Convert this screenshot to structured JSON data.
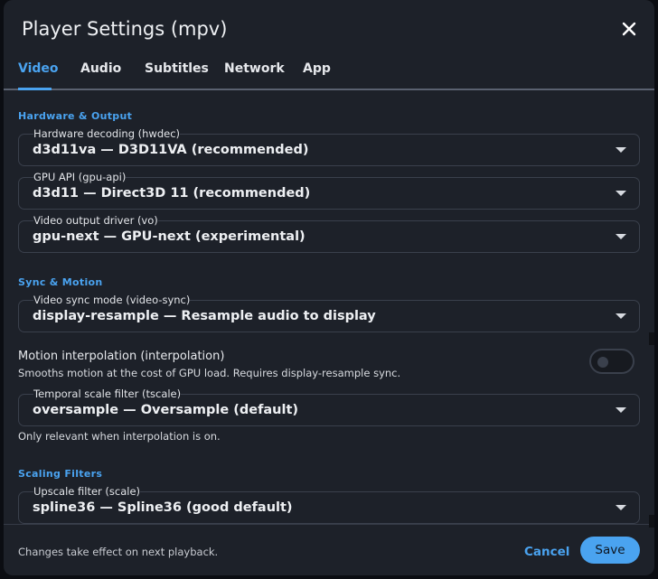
{
  "dialog": {
    "title": "Player Settings (mpv)",
    "close_icon": "close-icon"
  },
  "tabs": [
    {
      "label": "Video",
      "active": true
    },
    {
      "label": "Audio",
      "active": false
    },
    {
      "label": "Subtitles",
      "active": false
    },
    {
      "label": "Network",
      "active": false
    },
    {
      "label": "App",
      "active": false
    }
  ],
  "sections": {
    "hardware": {
      "label": "Hardware & Output",
      "hwdec": {
        "caption": "Hardware decoding (hwdec)",
        "value": "d3d11va — D3D11VA (recommended)"
      },
      "gpu_api": {
        "caption": "GPU API (gpu-api)",
        "value": "d3d11 — Direct3D 11 (recommended)"
      },
      "vo": {
        "caption": "Video output driver (vo)",
        "value": "gpu-next — GPU-next (experimental)"
      }
    },
    "sync": {
      "label": "Sync & Motion",
      "video_sync": {
        "caption": "Video sync mode (video-sync)",
        "value": "display-resample — Resample audio to display"
      },
      "interpolation": {
        "title": "Motion interpolation (interpolation)",
        "description": "Smooths motion at the cost of GPU load. Requires display-resample sync.",
        "enabled": false
      },
      "tscale": {
        "caption": "Temporal scale filter (tscale)",
        "value": "oversample — Oversample (default)"
      },
      "tscale_note": "Only relevant when interpolation is on."
    },
    "scaling": {
      "label": "Scaling Filters",
      "scale": {
        "caption": "Upscale filter (scale)",
        "value": "spline36 — Spline36 (good default)"
      }
    }
  },
  "footer": {
    "note": "Changes take effect on next playback.",
    "cancel_label": "Cancel",
    "save_label": "Save"
  },
  "colors": {
    "accent": "#4aa3f0",
    "panel": "#1d2129",
    "border": "#3a404c"
  }
}
